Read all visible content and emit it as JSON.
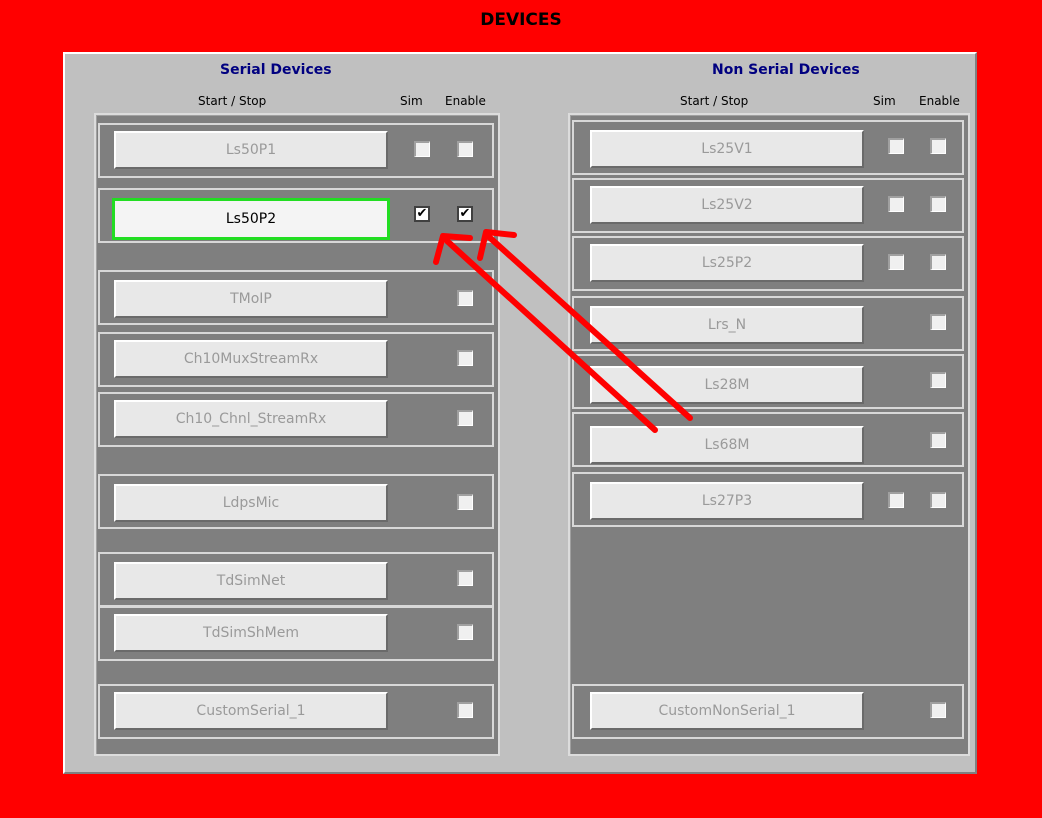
{
  "window": {
    "title": "DEVICES"
  },
  "serial": {
    "title": "Serial Devices",
    "col_start": "Start / Stop",
    "col_sim": "Sim",
    "col_enable": "Enable",
    "devices": [
      {
        "label": "Ls50P1",
        "sim": false,
        "enable": false
      },
      {
        "label": "Ls50P2",
        "sim": true,
        "enable": true
      },
      {
        "label": "TMoIP",
        "enable": false
      },
      {
        "label": "Ch10MuxStreamRx",
        "enable": false
      },
      {
        "label": "Ch10_Chnl_StreamRx",
        "enable": false
      },
      {
        "label": "LdpsMic",
        "enable": false
      },
      {
        "label": "TdSimNet",
        "enable": false
      },
      {
        "label": "TdSimShMem",
        "enable": false
      },
      {
        "label": "CustomSerial_1",
        "enable": false
      }
    ]
  },
  "nonserial": {
    "title": "Non Serial Devices",
    "col_start": "Start / Stop",
    "col_sim": "Sim",
    "col_enable": "Enable",
    "devices": [
      {
        "label": "Ls25V1",
        "sim": false,
        "enable": false
      },
      {
        "label": "Ls25V2",
        "sim": false,
        "enable": false
      },
      {
        "label": "Ls25P2",
        "sim": false,
        "enable": false
      },
      {
        "label": "Lrs_N",
        "enable": false
      },
      {
        "label": "Ls28M",
        "enable": false
      },
      {
        "label": "Ls68M",
        "enable": false
      },
      {
        "label": "Ls27P3",
        "sim": false,
        "enable": false
      },
      {
        "label": "CustomNonSerial_1",
        "enable": false
      }
    ]
  },
  "colors": {
    "background": "#ff0000",
    "panel": "#c0c0c0",
    "group": "#7f7f7f",
    "active_border": "#22dd22",
    "annotation_arrow": "#ff0000"
  },
  "check_glyph": "✔"
}
